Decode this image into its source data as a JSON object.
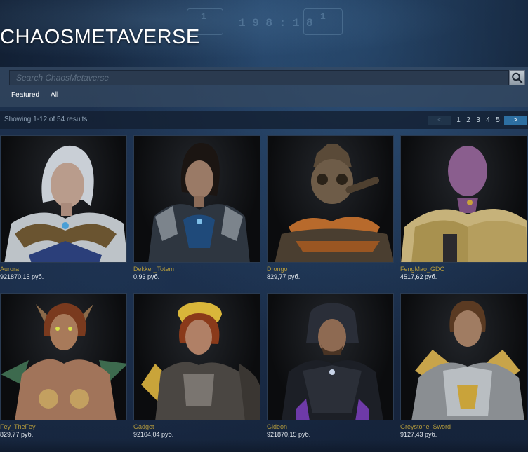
{
  "header": {
    "title": "CHAOSMETAVERSE"
  },
  "search": {
    "placeholder": "Search ChaosMetaverse"
  },
  "filters": {
    "featured": "Featured",
    "all": "All"
  },
  "results": {
    "showing": "Showing 1-12 of 54 results",
    "pager": {
      "prev": "<",
      "next": ">",
      "pages": [
        "1",
        "2",
        "3",
        "4",
        "5"
      ]
    }
  },
  "items": [
    {
      "name": "Aurora",
      "price": "921870,15 руб."
    },
    {
      "name": "Dekker_Totem",
      "price": "0,93 руб."
    },
    {
      "name": "Drongo",
      "price": "829,77 руб."
    },
    {
      "name": "FengMao_GDC",
      "price": "4517,62 руб."
    },
    {
      "name": "Fey_TheFey",
      "price": "829,77 руб."
    },
    {
      "name": "Gadget",
      "price": "92104,04 руб."
    },
    {
      "name": "Gideon",
      "price": "921870,15 руб."
    },
    {
      "name": "Greystone_Sword",
      "price": "9127,43 руб."
    }
  ],
  "colors": {
    "accent": "#2d6fa2",
    "item_name": "#b39a3c",
    "background": "#16233a"
  }
}
